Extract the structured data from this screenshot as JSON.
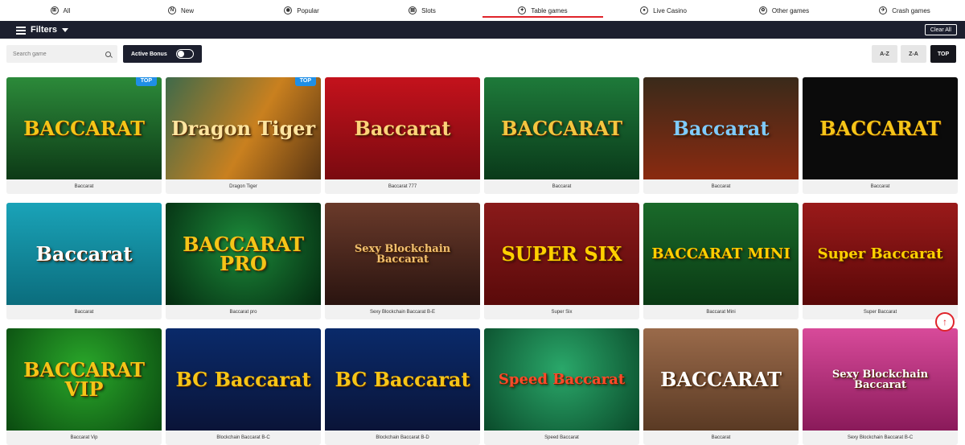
{
  "tabs": [
    {
      "label": "All",
      "icon": "grid-icon",
      "glyph": "⊞"
    },
    {
      "label": "New",
      "icon": "new-icon",
      "glyph": "N"
    },
    {
      "label": "Popular",
      "icon": "popular-icon",
      "glyph": "◉"
    },
    {
      "label": "Slots",
      "icon": "slots-icon",
      "glyph": "▤"
    },
    {
      "label": "Table games",
      "icon": "table-games-icon",
      "glyph": "✦",
      "active": true
    },
    {
      "label": "Live Casino",
      "icon": "live-casino-icon",
      "glyph": "●"
    },
    {
      "label": "Other games",
      "icon": "other-games-icon",
      "glyph": "✿"
    },
    {
      "label": "Crash games",
      "icon": "crash-games-icon",
      "glyph": "✈"
    }
  ],
  "filters": {
    "label": "Filters",
    "clear_all": "Clear All"
  },
  "search": {
    "placeholder": "Search game"
  },
  "bonus": {
    "label": "Active Bonus"
  },
  "sort": {
    "az": "A-Z",
    "za": "Z-A",
    "top": "TOP"
  },
  "colors": {
    "accent": "#e0242b",
    "dark": "#1c1f2e",
    "badge": "#1f8fe6"
  },
  "games": [
    {
      "name": "Baccarat",
      "art": "BACCARAT",
      "badge": "TOP",
      "bg": "linear-gradient(180deg,#2c8a3a,#0d3a16)",
      "fg": "#f5c518"
    },
    {
      "name": "Dragon Tiger",
      "art": "Dragon Tiger",
      "badge": "TOP",
      "bg": "linear-gradient(120deg,#3f6a4a,#c9801f 55%,#5a3512)",
      "fg": "#ffe6a0"
    },
    {
      "name": "Baccarat 777",
      "art": "Baccarat",
      "badge": "",
      "bg": "linear-gradient(180deg,#c4121c,#7a0a10)",
      "fg": "#ffd27a"
    },
    {
      "name": "Baccarat",
      "art": "BACCARAT",
      "badge": "",
      "bg": "linear-gradient(180deg,#1e7a3a,#0a3a1a)",
      "fg": "#f2c640"
    },
    {
      "name": "Baccarat",
      "art": "Baccarat",
      "badge": "",
      "bg": "linear-gradient(180deg,#3a2a1a,#8a2a10)",
      "fg": "#7ecbff"
    },
    {
      "name": "Baccarat",
      "art": "BACCARAT",
      "badge": "",
      "bg": "#0b0b0b",
      "fg": "#f5c518"
    },
    {
      "name": "Baccarat",
      "art": "Baccarat",
      "badge": "",
      "bg": "linear-gradient(180deg,#1aa3b8,#0b6d7d)",
      "fg": "#ffffff"
    },
    {
      "name": "Baccarat pro",
      "art": "BACCARAT PRO",
      "badge": "",
      "bg": "radial-gradient(circle at 50% 40%,#1c8a3a,#042a10)",
      "fg": "#f5c518"
    },
    {
      "name": "Sexy Blockchain Baccarat B-E",
      "art": "Sexy Blockchain Baccarat",
      "badge": "",
      "bg": "linear-gradient(180deg,#6a3a2a,#2a1410)",
      "fg": "#f0c070"
    },
    {
      "name": "Super Six",
      "art": "SUPER SIX",
      "badge": "",
      "bg": "linear-gradient(180deg,#8a1a1a,#5a0a0a)",
      "fg": "#ffd000"
    },
    {
      "name": "Baccarat Mini",
      "art": "BACCARAT MINI",
      "badge": "",
      "bg": "linear-gradient(180deg,#1a6a2a,#0a3a14)",
      "fg": "#ffd000"
    },
    {
      "name": "Super Baccarat",
      "art": "Super Baccarat",
      "badge": "",
      "bg": "linear-gradient(180deg,#9a1a1a,#5a0808)",
      "fg": "#ffd000"
    },
    {
      "name": "Baccarat Vip",
      "art": "BACCARAT VIP",
      "badge": "",
      "bg": "radial-gradient(circle at 50% 40%,#2aa82a,#0a4a10)",
      "fg": "#f5c518"
    },
    {
      "name": "Blockchain Baccarat B-C",
      "art": "BC Baccarat",
      "badge": "",
      "bg": "linear-gradient(180deg,#0a2a6a,#0a1438)",
      "fg": "#f5c518"
    },
    {
      "name": "Blockchain Baccarat B-D",
      "art": "BC Baccarat",
      "badge": "",
      "bg": "linear-gradient(180deg,#0a2a6a,#0a1438)",
      "fg": "#f5c518"
    },
    {
      "name": "Speed Baccarat",
      "art": "Speed Baccarat",
      "badge": "",
      "bg": "radial-gradient(circle at 50% 40%,#2aa86a,#0a4a2a)",
      "fg": "#ff4a2a"
    },
    {
      "name": "Baccarat",
      "art": "BACCARAT",
      "badge": "",
      "bg": "linear-gradient(180deg,#9a6a4a,#5a3a24)",
      "fg": "#ffffff"
    },
    {
      "name": "Sexy Blockchain Baccarat B-C",
      "art": "Sexy Blockchain Baccarat",
      "badge": "",
      "bg": "linear-gradient(180deg,#d84a9a,#8a1a5a)",
      "fg": "#ffffff"
    }
  ]
}
